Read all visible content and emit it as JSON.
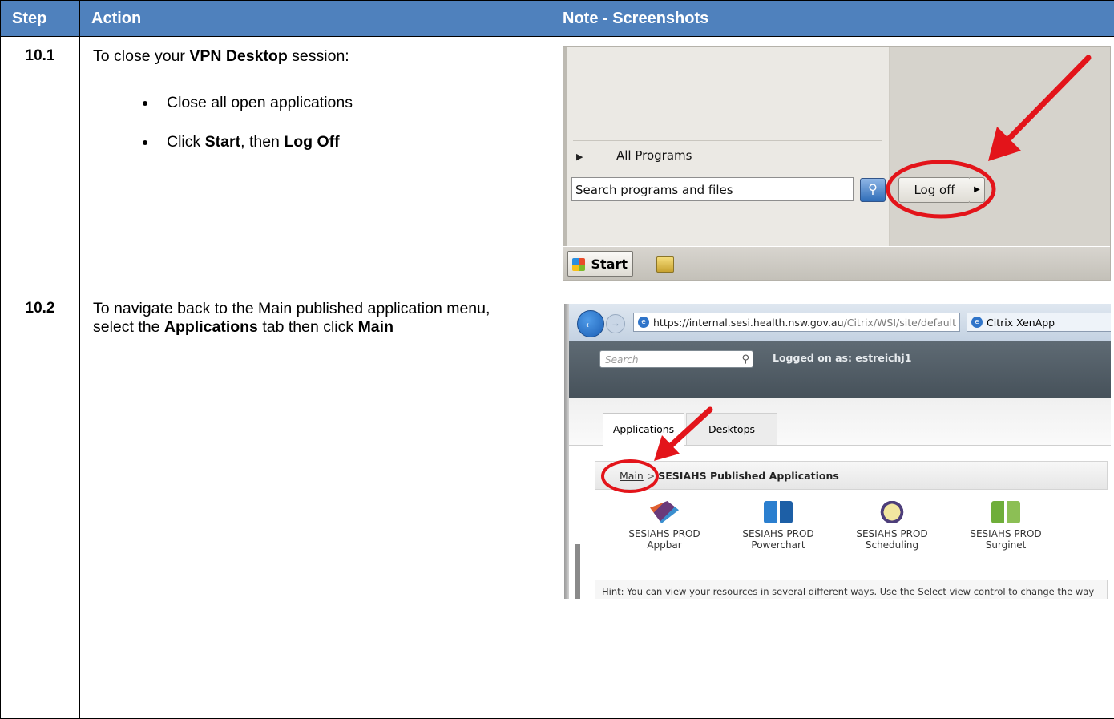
{
  "table": {
    "headers": [
      "Step",
      "Action",
      "Note - Screenshots"
    ],
    "rows": [
      {
        "step": "10.1",
        "intro_before": "To close your ",
        "intro_bold": "VPN Desktop",
        "intro_after": " session:",
        "bullets": [
          {
            "text": "Close all open applications"
          },
          {
            "pre": "Click ",
            "bold1": "Start",
            "mid": ", then ",
            "bold2": "Log Off"
          }
        ]
      },
      {
        "step": "10.2",
        "text_before": "To navigate back to the Main published application menu, select the ",
        "bold1": "Applications",
        "text_mid": " tab then click ",
        "bold2": "Main"
      }
    ]
  },
  "screenshot1": {
    "all_programs": "All Programs",
    "search_placeholder": "Search programs and files",
    "logoff_label": "Log off",
    "start_label": "Start"
  },
  "screenshot2": {
    "url_main": "https://internal.sesi.health.nsw.gov.au",
    "url_path": "/Citrix/WSI/site/default",
    "tab_title": "Citrix XenApp",
    "search_placeholder": "Search",
    "logged_on": "Logged on as: estreichj1",
    "tabs": [
      "Applications",
      "Desktops"
    ],
    "breadcrumb_main": "Main",
    "breadcrumb_sep": " > ",
    "breadcrumb_current": "SESIAHS Published Applications",
    "apps": [
      {
        "line1": "SESIAHS PROD",
        "line2": "Appbar",
        "icon": "appbar-icon"
      },
      {
        "line1": "SESIAHS PROD",
        "line2": "Powerchart",
        "icon": "powerchart-icon"
      },
      {
        "line1": "SESIAHS PROD",
        "line2": "Scheduling",
        "icon": "scheduling-icon"
      },
      {
        "line1": "SESIAHS PROD",
        "line2": "Surginet",
        "icon": "surginet-icon"
      }
    ],
    "hint": "Hint: You can view your resources in several different ways. Use the Select view control to change the way"
  },
  "colors": {
    "header_bg": "#4f81bd",
    "annotation_red": "#e3141a"
  }
}
